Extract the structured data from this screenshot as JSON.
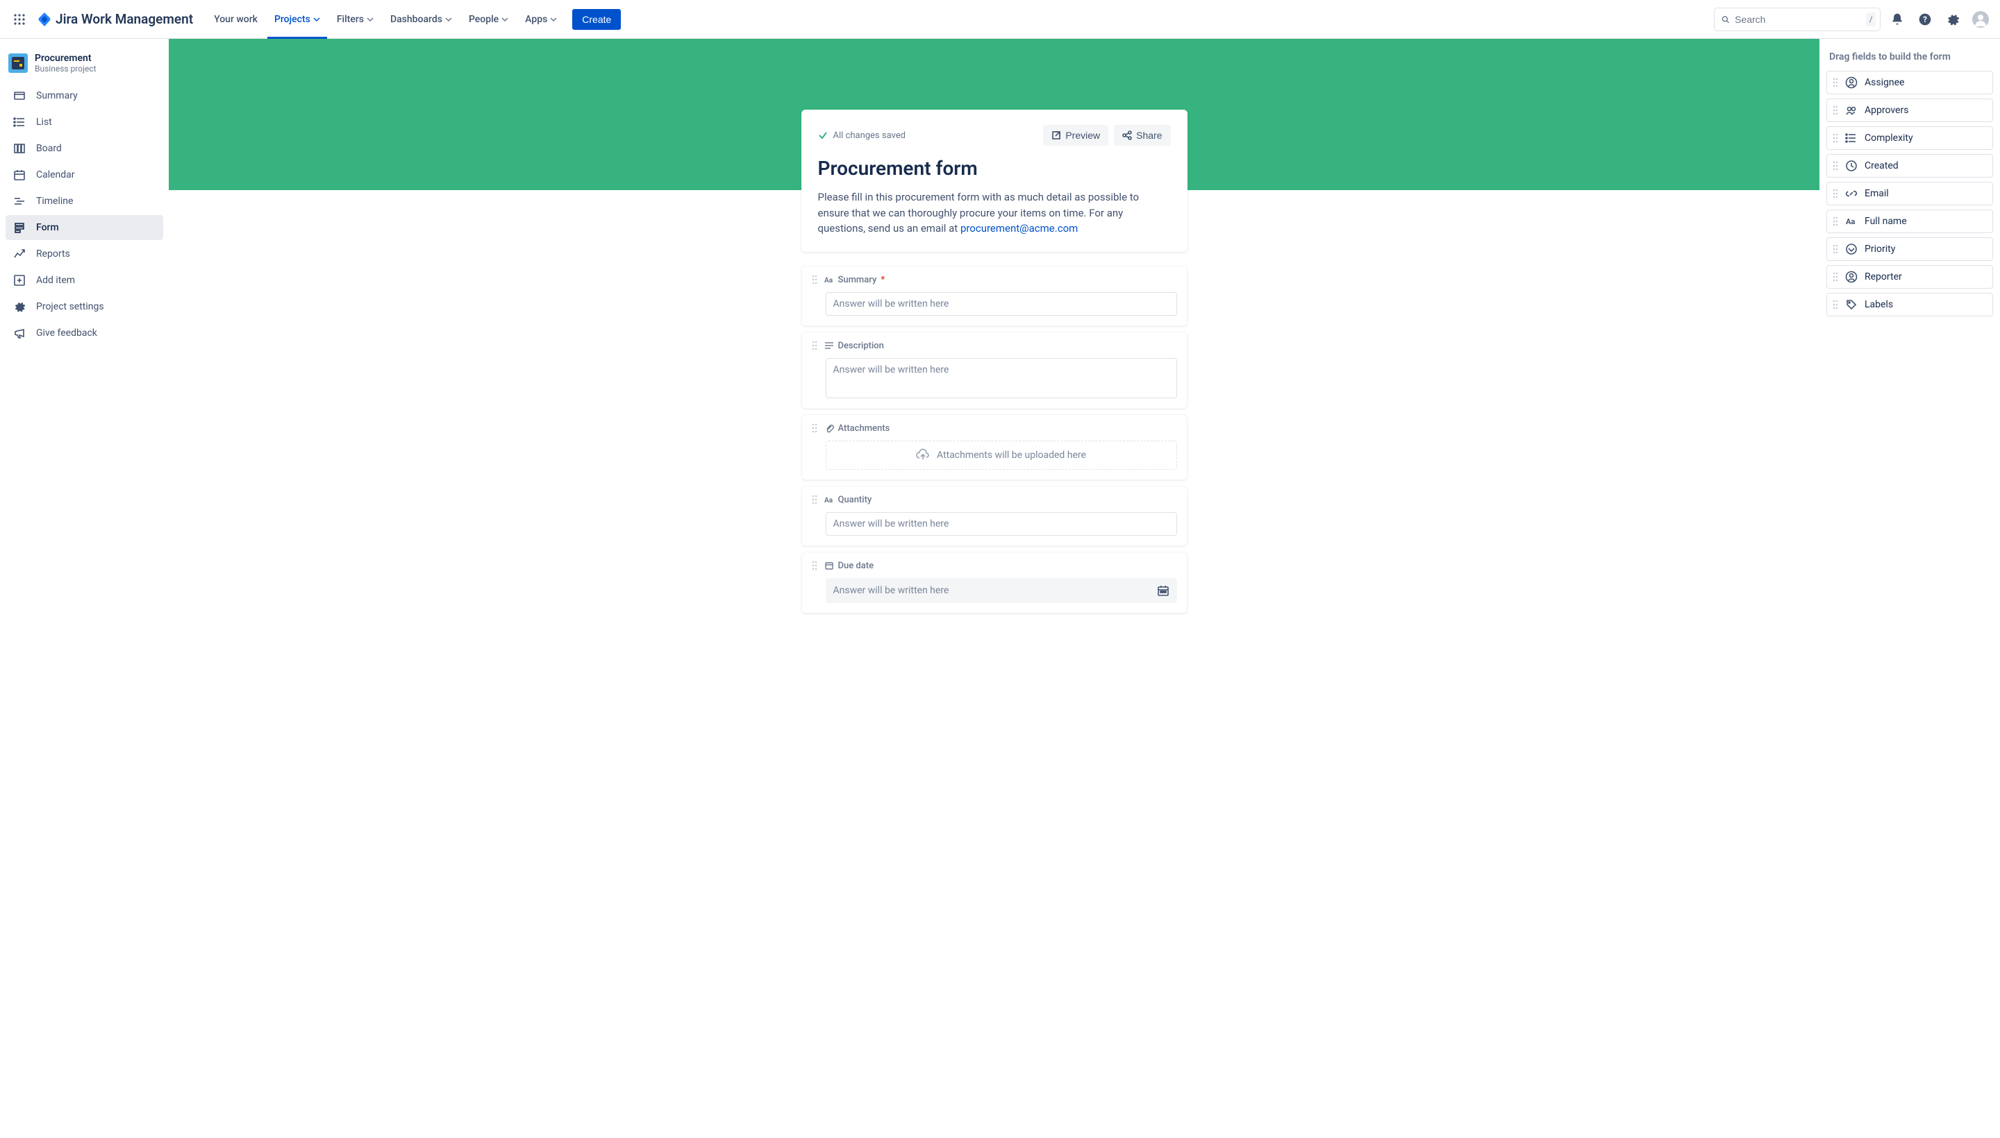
{
  "brand": "Jira Work Management",
  "nav": {
    "your_work": "Your work",
    "projects": "Projects",
    "filters": "Filters",
    "dashboards": "Dashboards",
    "people": "People",
    "apps": "Apps",
    "create": "Create"
  },
  "search": {
    "placeholder": "Search",
    "shortcut": "/"
  },
  "project": {
    "name": "Procurement",
    "type": "Business project"
  },
  "sidebar": {
    "items": [
      {
        "label": "Summary"
      },
      {
        "label": "List"
      },
      {
        "label": "Board"
      },
      {
        "label": "Calendar"
      },
      {
        "label": "Timeline"
      },
      {
        "label": "Form"
      },
      {
        "label": "Reports"
      },
      {
        "label": "Add item"
      },
      {
        "label": "Project settings"
      },
      {
        "label": "Give feedback"
      }
    ]
  },
  "form": {
    "status": "All changes saved",
    "preview": "Preview",
    "share": "Share",
    "title": "Procurement form",
    "desc_pre": "Please fill in this procurement form with as much detail as possible to ensure that we can thoroughly procure your items on time. For any questions, send us an email at ",
    "desc_link": "procurement@acme.com",
    "placeholder": "Answer will be written here",
    "upload_hint": "Attachments will be uploaded here",
    "fields": {
      "summary": "Summary",
      "description": "Description",
      "attachments": "Attachments",
      "quantity": "Quantity",
      "due_date": "Due date"
    }
  },
  "palette": {
    "title": "Drag fields to build the form",
    "items": [
      {
        "label": "Assignee"
      },
      {
        "label": "Approvers"
      },
      {
        "label": "Complexity"
      },
      {
        "label": "Created"
      },
      {
        "label": "Email"
      },
      {
        "label": "Full name"
      },
      {
        "label": "Priority"
      },
      {
        "label": "Reporter"
      },
      {
        "label": "Labels"
      }
    ]
  }
}
